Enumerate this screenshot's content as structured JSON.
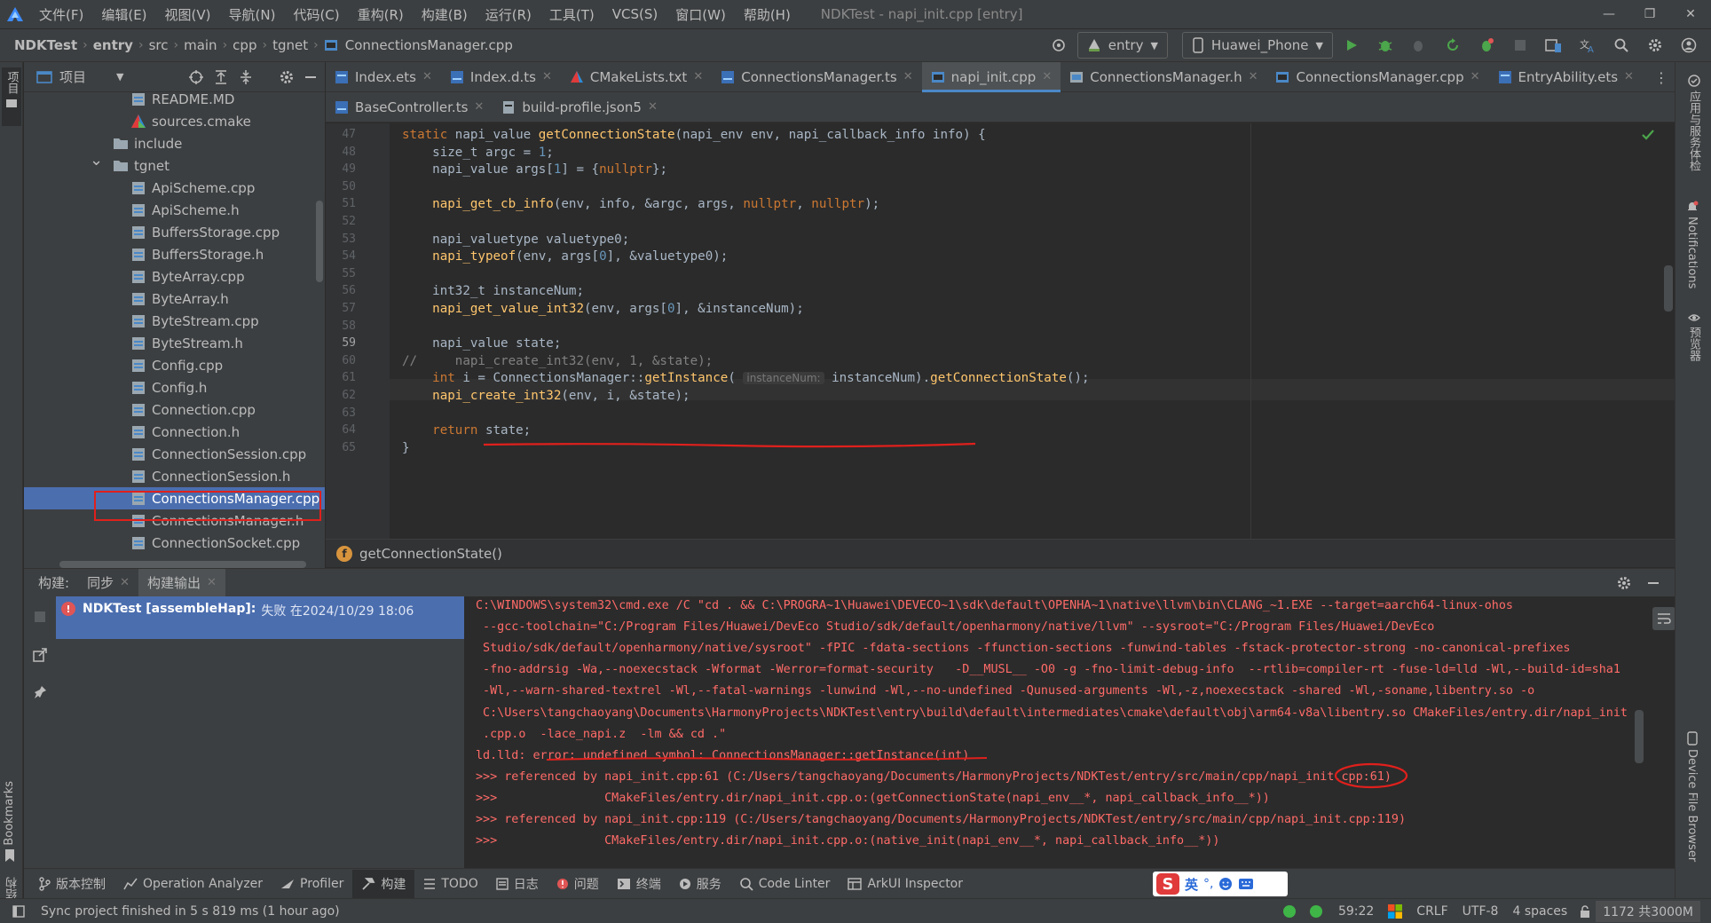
{
  "menu": {
    "items": [
      "文件(F)",
      "编辑(E)",
      "视图(V)",
      "导航(N)",
      "代码(C)",
      "重构(R)",
      "构建(B)",
      "运行(R)",
      "工具(T)",
      "VCS(S)",
      "窗口(W)",
      "帮助(H)"
    ],
    "window_title": "NDKTest - napi_init.cpp [entry]"
  },
  "nav": {
    "breadcrumbs": [
      "NDKTest",
      "entry",
      "src",
      "main",
      "cpp",
      "tgnet",
      "ConnectionsManager.cpp"
    ],
    "run_config": "entry",
    "device": "Huawei_Phone"
  },
  "left_stripe": {
    "project_label": "项目",
    "bookmarks_label": "Bookmarks",
    "structure_label": "结构"
  },
  "project_panel": {
    "title": "项目",
    "tree": [
      {
        "label": "README.MD",
        "kind": "file",
        "depth": 3
      },
      {
        "label": "sources.cmake",
        "kind": "cmake",
        "depth": 3
      },
      {
        "label": "include",
        "kind": "folder",
        "depth": 2
      },
      {
        "label": "tgnet",
        "kind": "folder-open",
        "depth": 2
      },
      {
        "label": "ApiScheme.cpp",
        "kind": "file",
        "depth": 3
      },
      {
        "label": "ApiScheme.h",
        "kind": "file",
        "depth": 3
      },
      {
        "label": "BuffersStorage.cpp",
        "kind": "file",
        "depth": 3
      },
      {
        "label": "BuffersStorage.h",
        "kind": "file",
        "depth": 3
      },
      {
        "label": "ByteArray.cpp",
        "kind": "file",
        "depth": 3
      },
      {
        "label": "ByteArray.h",
        "kind": "file",
        "depth": 3
      },
      {
        "label": "ByteStream.cpp",
        "kind": "file",
        "depth": 3
      },
      {
        "label": "ByteStream.h",
        "kind": "file",
        "depth": 3
      },
      {
        "label": "Config.cpp",
        "kind": "file",
        "depth": 3
      },
      {
        "label": "Config.h",
        "kind": "file",
        "depth": 3
      },
      {
        "label": "Connection.cpp",
        "kind": "file",
        "depth": 3
      },
      {
        "label": "Connection.h",
        "kind": "file",
        "depth": 3
      },
      {
        "label": "ConnectionSession.cpp",
        "kind": "file",
        "depth": 3
      },
      {
        "label": "ConnectionSession.h",
        "kind": "file",
        "depth": 3
      },
      {
        "label": "ConnectionsManager.cpp",
        "kind": "file",
        "depth": 3,
        "selected": true
      },
      {
        "label": "ConnectionsManager.h",
        "kind": "file",
        "depth": 3
      },
      {
        "label": "ConnectionSocket.cpp",
        "kind": "file",
        "depth": 3
      }
    ]
  },
  "tabs_row1": [
    {
      "label": "Index.ets",
      "icon": "ets-file-icon"
    },
    {
      "label": "Index.d.ts",
      "icon": "ts-file-icon"
    },
    {
      "label": "CMakeLists.txt",
      "icon": "cmake-icon"
    },
    {
      "label": "ConnectionsManager.ts",
      "icon": "ts-file-icon"
    },
    {
      "label": "napi_init.cpp",
      "icon": "cpp-file-icon",
      "active": true
    },
    {
      "label": "ConnectionsManager.h",
      "icon": "h-file-icon"
    },
    {
      "label": "ConnectionsManager.cpp",
      "icon": "cpp-file-icon"
    },
    {
      "label": "EntryAbility.ets",
      "icon": "ets-file-icon"
    }
  ],
  "tabs_row2": [
    {
      "label": "BaseController.ts",
      "icon": "ts-file-icon"
    },
    {
      "label": "build-profile.json5",
      "icon": "json-file-icon"
    }
  ],
  "editor": {
    "lines": [
      {
        "n": "47",
        "html": "<span class='kw'>static</span> napi_value <span class='fn'>getConnectionState</span>(napi_env env, napi_callback_info info) {"
      },
      {
        "n": "48",
        "html": "    size_t argc = <span class='num'>1</span>;"
      },
      {
        "n": "49",
        "html": "    napi_value args[<span class='num'>1</span>] = {<span class='kw'>nullptr</span>};"
      },
      {
        "n": "50",
        "html": ""
      },
      {
        "n": "51",
        "html": "    <span class='fn'>napi_get_cb_info</span>(env, info, &amp;argc, args, <span class='kw'>nullptr</span>, <span class='kw'>nullptr</span>);"
      },
      {
        "n": "52",
        "html": ""
      },
      {
        "n": "53",
        "html": "    napi_valuetype valuetype0;"
      },
      {
        "n": "54",
        "html": "    <span class='fn'>napi_typeof</span>(env, args[<span class='num'>0</span>], &amp;valuetype0);"
      },
      {
        "n": "55",
        "html": ""
      },
      {
        "n": "56",
        "html": "    int32_t instanceNum;"
      },
      {
        "n": "57",
        "html": "    <span class='fn'>napi_get_value_int32</span>(env, args[<span class='num'>0</span>], &amp;instanceNum);"
      },
      {
        "n": "58",
        "html": ""
      },
      {
        "n": "59",
        "html": "    napi_value state;"
      },
      {
        "n": "60",
        "html": "<span class='cmt'>//     napi_create_int32(env, 1, &amp;state);</span>"
      },
      {
        "n": "61",
        "html": "    <span class='kw'>int</span> i = ConnectionsManager::<span class='fn'>getInstance</span>( <span class='hint'>instanceNum:</span> instanceNum).<span class='fn'>getConnectionState</span>();"
      },
      {
        "n": "62",
        "html": "    <span class='fn'>napi_create_int32</span>(env, i, &amp;state);"
      },
      {
        "n": "63",
        "html": ""
      },
      {
        "n": "64",
        "html": "    <span class='kw'>return</span> state;"
      },
      {
        "n": "65",
        "html": "}"
      }
    ],
    "breadcrumb_function": "getConnectionState()"
  },
  "build": {
    "tabs": [
      "构建:",
      "同步",
      "构建输出"
    ],
    "task": "NDKTest [assembleHap]:",
    "task_status": "失败 在2024/10/29 18:06",
    "output_lines": [
      "C:\\WINDOWS\\system32\\cmd.exe /C \"cd . && C:\\PROGRA~1\\Huawei\\DEVECO~1\\sdk\\default\\OPENHA~1\\native\\llvm\\bin\\CLANG_~1.EXE --target=aarch64-linux-ohos",
      " --gcc-toolchain=\"C:/Program Files/Huawei/DevEco Studio/sdk/default/openharmony/native/llvm\" --sysroot=\"C:/Program Files/Huawei/DevEco",
      " Studio/sdk/default/openharmony/native/sysroot\" -fPIC -fdata-sections -ffunction-sections -funwind-tables -fstack-protector-strong -no-canonical-prefixes",
      " -fno-addrsig -Wa,--noexecstack -Wformat -Werror=format-security   -D__MUSL__ -O0 -g -fno-limit-debug-info  --rtlib=compiler-rt -fuse-ld=lld -Wl,--build-id=sha1",
      " -Wl,--warn-shared-textrel -Wl,--fatal-warnings -lunwind -Wl,--no-undefined -Qunused-arguments -Wl,-z,noexecstack -shared -Wl,-soname,libentry.so -o",
      " C:\\Users\\tangchaoyang\\Documents\\HarmonyProjects\\NDKTest\\entry\\build\\default\\intermediates\\cmake\\default\\obj\\arm64-v8a\\libentry.so CMakeFiles/entry.dir/napi_init",
      " .cpp.o  -lace_napi.z  -lm && cd .\"",
      "ld.lld: error: undefined symbol: ConnectionsManager::getInstance(int)",
      ">>> referenced by napi_init.cpp:61 (C:/Users/tangchaoyang/Documents/HarmonyProjects/NDKTest/entry/src/main/cpp/napi_init.cpp:61)",
      ">>>               CMakeFiles/entry.dir/napi_init.cpp.o:(getConnectionState(napi_env__*, napi_callback_info__*))",
      ">>> referenced by napi_init.cpp:119 (C:/Users/tangchaoyang/Documents/HarmonyProjects/NDKTest/entry/src/main/cpp/napi_init.cpp:119)",
      ">>>               CMakeFiles/entry.dir/napi_init.cpp.o:(native_init(napi_env__*, napi_callback_info__*))"
    ]
  },
  "right_stripe": {
    "labels": [
      "应用与服务体检",
      "Notifications",
      "预览器",
      "Device File Browser"
    ]
  },
  "tool_windows": [
    {
      "label": "版本控制",
      "icon": "branch-icon"
    },
    {
      "label": "Operation Analyzer",
      "icon": "chart-icon"
    },
    {
      "label": "Profiler",
      "icon": "profiler-icon"
    },
    {
      "label": "构建",
      "icon": "hammer-icon",
      "active": true
    },
    {
      "label": "TODO",
      "icon": "list-icon"
    },
    {
      "label": "日志",
      "icon": "log-icon"
    },
    {
      "label": "问题",
      "icon": "problem-icon"
    },
    {
      "label": "终端",
      "icon": "terminal-icon"
    },
    {
      "label": "服务",
      "icon": "services-icon"
    },
    {
      "label": "Code Linter",
      "icon": "linter-icon"
    },
    {
      "label": "ArkUI Inspector",
      "icon": "inspector-icon"
    }
  ],
  "ime": {
    "label": "英"
  },
  "status": {
    "message": "Sync project finished in 5 s 819 ms (1 hour ago)",
    "position": "59:22",
    "line_sep": "CRLF",
    "encoding": "UTF-8",
    "indent": "4 spaces",
    "memory": "1172 共3000M"
  },
  "colors": {
    "accent": "#4a88c7",
    "error": "#ff6b68",
    "annotation_red": "#e0201c",
    "selection": "#4b6eaf"
  }
}
